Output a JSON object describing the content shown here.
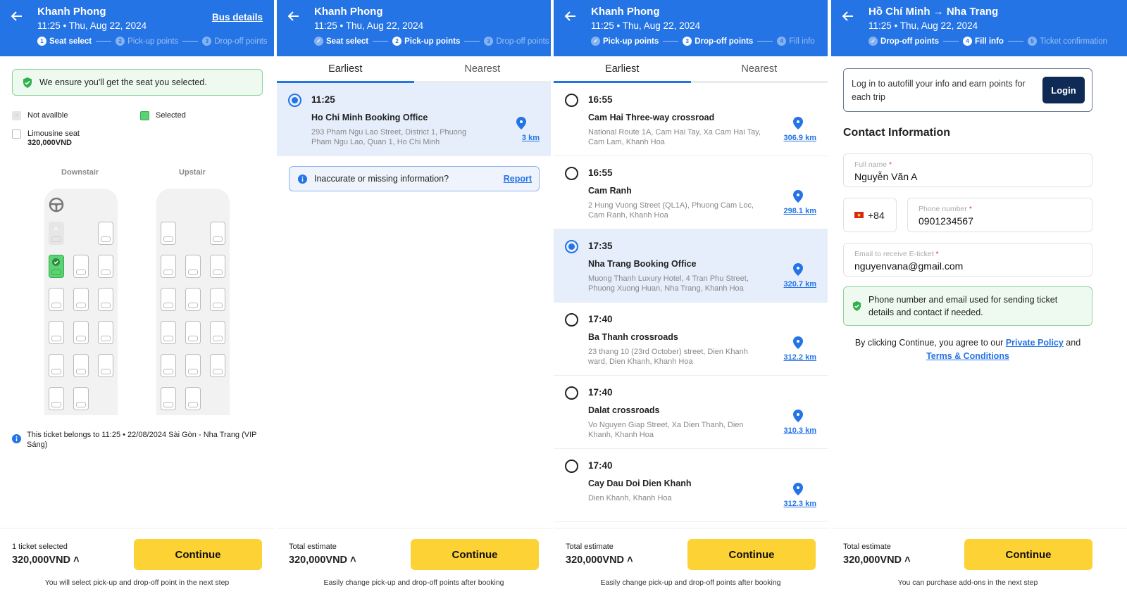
{
  "colors": {
    "brand": "#2474e5",
    "cta": "#fdd235",
    "success": "#2fb14c",
    "login": "#0e2a55"
  },
  "screens": [
    {
      "header": {
        "title": "Khanh Phong",
        "subtitle": "11:25 • Thu, Aug 22, 2024",
        "link": "Bus details",
        "steps": [
          {
            "num": "1",
            "label": "Seat select",
            "state": "active"
          },
          {
            "num": "2",
            "label": "Pick-up points",
            "state": "pending"
          },
          {
            "num": "3",
            "label": "Drop-off points",
            "state": "pending"
          }
        ]
      },
      "guarantee": "We ensure you'll get the seat you selected.",
      "legend": {
        "not_available": "Not availble",
        "selected": "Selected",
        "limousine": "Limousine seat",
        "limousine_price": "320,000VND"
      },
      "decks": {
        "downstair": "Downstair",
        "upstair": "Upstair"
      },
      "ticket_info": "This ticket belongs to 11:25 • 22/08/2024 Sài Gòn - Nha Trang (VIP Sáng)",
      "footer": {
        "label": "1 ticket selected",
        "price": "320,000VND",
        "button": "Continue",
        "note": "You will select pick-up and drop-off point in the next step"
      }
    },
    {
      "header": {
        "title": "Khanh Phong",
        "subtitle": "11:25 • Thu, Aug 22, 2024",
        "steps": [
          {
            "num": "✓",
            "label": "Seat select",
            "state": "done"
          },
          {
            "num": "2",
            "label": "Pick-up points",
            "state": "active"
          },
          {
            "num": "3",
            "label": "Drop-off points",
            "state": "pending"
          }
        ]
      },
      "tabs": [
        "Earliest",
        "Nearest"
      ],
      "points": [
        {
          "time": "11:25",
          "name": "Ho Chi Minh Booking Office",
          "address": "293 Pham Ngu Lao Street, District 1, Phuong Pham Ngu Lao, Quan 1, Ho Chi Minh",
          "distance": "3 km",
          "selected": true
        }
      ],
      "report": {
        "text": "Inaccurate or missing information?",
        "link": "Report"
      },
      "footer": {
        "label": "Total estimate",
        "price": "320,000VND",
        "button": "Continue",
        "note": "Easily change pick-up and drop-off points after booking"
      }
    },
    {
      "header": {
        "title": "Khanh Phong",
        "subtitle": "11:25 • Thu, Aug 22, 2024",
        "steps": [
          {
            "num": "✓",
            "label": "Pick-up points",
            "state": "done"
          },
          {
            "num": "3",
            "label": "Drop-off points",
            "state": "active"
          },
          {
            "num": "4",
            "label": "Fill info",
            "state": "pending"
          }
        ]
      },
      "tabs": [
        "Earliest",
        "Nearest"
      ],
      "points": [
        {
          "time": "16:55",
          "name": "Cam Hai Three-way crossroad",
          "address": "National Route 1A, Cam Hai Tay, Xa Cam Hai Tay, Cam Lam, Khanh Hoa",
          "distance": "306.9 km",
          "selected": false
        },
        {
          "time": "16:55",
          "name": "Cam Ranh",
          "address": "2 Hung Vuong Street (QL1A), Phuong Cam Loc, Cam Ranh, Khanh Hoa",
          "distance": "298.1 km",
          "selected": false
        },
        {
          "time": "17:35",
          "name": "Nha Trang Booking Office",
          "address": "Muong Thanh Luxury Hotel, 4 Tran Phu Street, Phuong Xuong Huan, Nha Trang, Khanh Hoa",
          "distance": "320.7 km",
          "selected": true
        },
        {
          "time": "17:40",
          "name": "Ba Thanh crossroads",
          "address": "23 thang 10 (23rd October) street, Dien Khanh ward, Dien Khanh, Khanh Hoa",
          "distance": "312.2 km",
          "selected": false
        },
        {
          "time": "17:40",
          "name": "Dalat crossroads",
          "address": "Vo Nguyen Giap Street, Xa Dien Thanh, Dien Khanh, Khanh Hoa",
          "distance": "310.3 km",
          "selected": false
        },
        {
          "time": "17:40",
          "name": "Cay Dau Doi Dien Khanh",
          "address": "Dien Khanh, Khanh Hoa",
          "distance": "312.3 km",
          "selected": false
        }
      ],
      "footer": {
        "label": "Total estimate",
        "price": "320,000VND",
        "button": "Continue",
        "note": "Easily change pick-up and drop-off points after booking"
      }
    },
    {
      "header": {
        "title": "Hồ Chí Minh → Nha Trang",
        "subtitle": "11:25 • Thu, Aug 22, 2024",
        "steps": [
          {
            "num": "✓",
            "label": "Drop-off points",
            "state": "done"
          },
          {
            "num": "4",
            "label": "Fill info",
            "state": "active"
          },
          {
            "num": "5",
            "label": "Ticket confirmation",
            "state": "pending"
          }
        ]
      },
      "login": {
        "text": "Log in to autofill your info and earn points for each trip",
        "button": "Login"
      },
      "contact_heading": "Contact Information",
      "fields": {
        "full_name": {
          "label": "Full name",
          "value": "Nguyễn Văn A"
        },
        "country_code": "+84",
        "phone": {
          "label": "Phone number",
          "value": "0901234567"
        },
        "email": {
          "label": "Email to receive E-ticket",
          "value": "nguyenvana@gmail.com"
        }
      },
      "info": "Phone number and email used for sending ticket details and contact if needed.",
      "agree": {
        "prefix": "By clicking Continue, you agree to our ",
        "policy": "Private Policy",
        "and": " and ",
        "terms": "Terms & Conditions"
      },
      "footer": {
        "label": "Total estimate",
        "price": "320,000VND",
        "button": "Continue",
        "note": "You can purchase add-ons in the next step"
      }
    }
  ]
}
